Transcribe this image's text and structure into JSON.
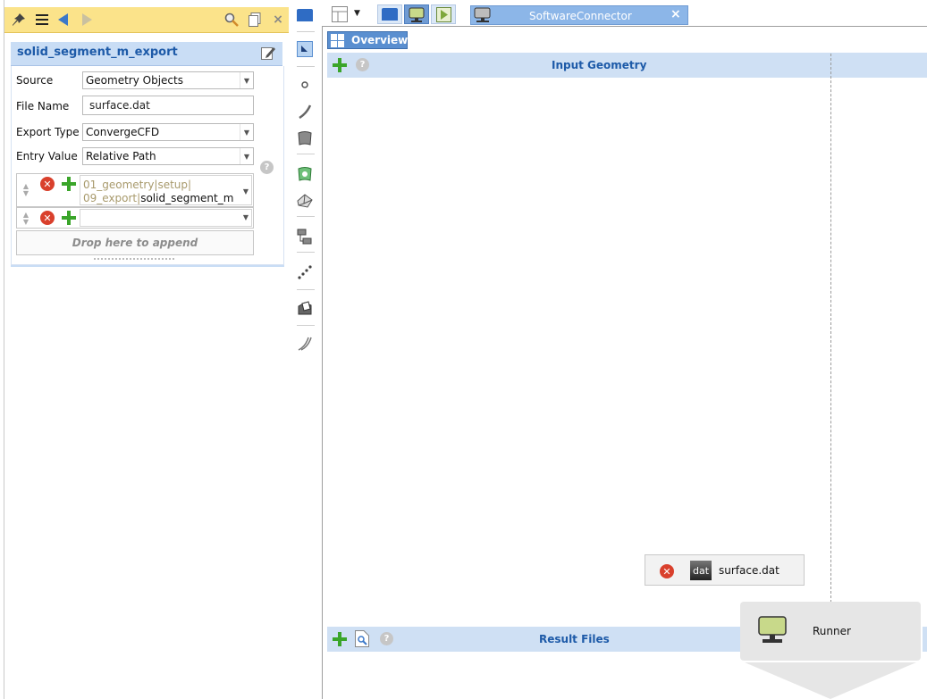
{
  "left_toolbar": {
    "icons": [
      "pin-icon",
      "list-icon",
      "back-icon",
      "forward-icon",
      "search-icon",
      "copy-icon",
      "close-icon"
    ]
  },
  "properties": {
    "title": "solid_segment_m_export",
    "source_label": "Source",
    "source_value": "Geometry Objects",
    "filename_label": "File Name",
    "filename_value": "surface.dat",
    "export_type_label": "Export Type",
    "export_type_value": "ConvergeCFD",
    "entry_value_label": "Entry Value",
    "entry_value_value": "Relative Path",
    "entry_line1": "01_geometry|setup|",
    "entry_line2_prefix": "09_export|",
    "entry_line2_value": "solid_segment_m",
    "entry2_value": "",
    "drop_text": "Drop here to append"
  },
  "tabs": {
    "active_label": "SoftwareConnector"
  },
  "overview": {
    "label": "Overview"
  },
  "sections": {
    "input_title": "Input Geometry",
    "result_title": "Result Files"
  },
  "file_chip": {
    "icon_text": "dat",
    "name": "surface.dat"
  },
  "runner": {
    "label": "Runner"
  },
  "colors": {
    "toolbar_yellow": "#fbe38a",
    "header_blue": "#c9ddf5",
    "accent_blue": "#1d5aa8",
    "tab_blue": "#8cb6e8",
    "add_green": "#3aa52a",
    "remove_red": "#d9402c"
  }
}
